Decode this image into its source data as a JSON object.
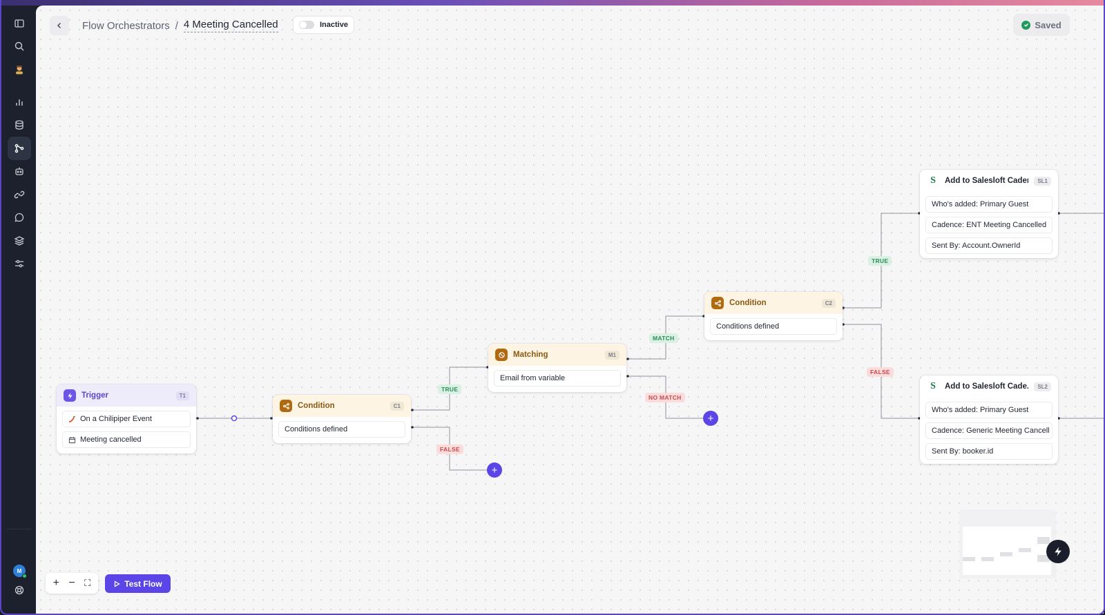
{
  "breadcrumb": {
    "parent": "Flow Orchestrators",
    "separator": "/",
    "current": "4 Meeting Cancelled"
  },
  "status_toggle": {
    "label": "Inactive"
  },
  "save_status": {
    "label": "Saved"
  },
  "nodes": {
    "trigger": {
      "title": "Trigger",
      "tag": "T1",
      "rows": [
        "On a Chilipiper Event",
        "Meeting cancelled"
      ]
    },
    "condition1": {
      "title": "Condition",
      "tag": "C1",
      "rows": [
        "Conditions defined"
      ]
    },
    "matching": {
      "title": "Matching",
      "tag": "M1",
      "rows": [
        "Email from variable"
      ]
    },
    "condition2": {
      "title": "Condition",
      "tag": "C2",
      "rows": [
        "Conditions defined"
      ]
    },
    "salesloft1": {
      "title": "Add to Salesloft Caden...",
      "tag": "SL1",
      "rows": [
        "Who's added: Primary Guest",
        "Cadence: ENT Meeting Cancelled",
        "Sent By: Account.OwnerId"
      ]
    },
    "salesloft2": {
      "title": "Add to Salesloft Cade...",
      "tag": "SL2",
      "rows": [
        "Who's added: Primary Guest",
        "Cadence: Generic Meeting Cancell",
        "Sent By: booker.id"
      ]
    }
  },
  "edge_labels": {
    "c1_true": "TRUE",
    "c1_false": "FALSE",
    "m1_match": "MATCH",
    "m1_nomatch": "NO MATCH",
    "c2_true": "TRUE",
    "c2_false": "FALSE"
  },
  "controls": {
    "zoom_in": "+",
    "zoom_out": "−",
    "fit": "⛶",
    "test_flow": "Test Flow"
  },
  "icons": {
    "sidebar": [
      "panel-toggle-icon",
      "search-icon",
      "user-avatar-icon",
      "analytics-icon",
      "database-icon",
      "flow-icon",
      "bot-icon",
      "link-icon",
      "chat-icon",
      "layers-icon",
      "settings-sliders-icon",
      "account-avatar-icon",
      "help-icon"
    ]
  },
  "colors": {
    "accent": "#5b45e6",
    "trigger": "#6a55e6",
    "condition": "#b06a10",
    "salesloft": "#1f7a4d",
    "true": "#2f8a5a",
    "false": "#c84a4a"
  }
}
